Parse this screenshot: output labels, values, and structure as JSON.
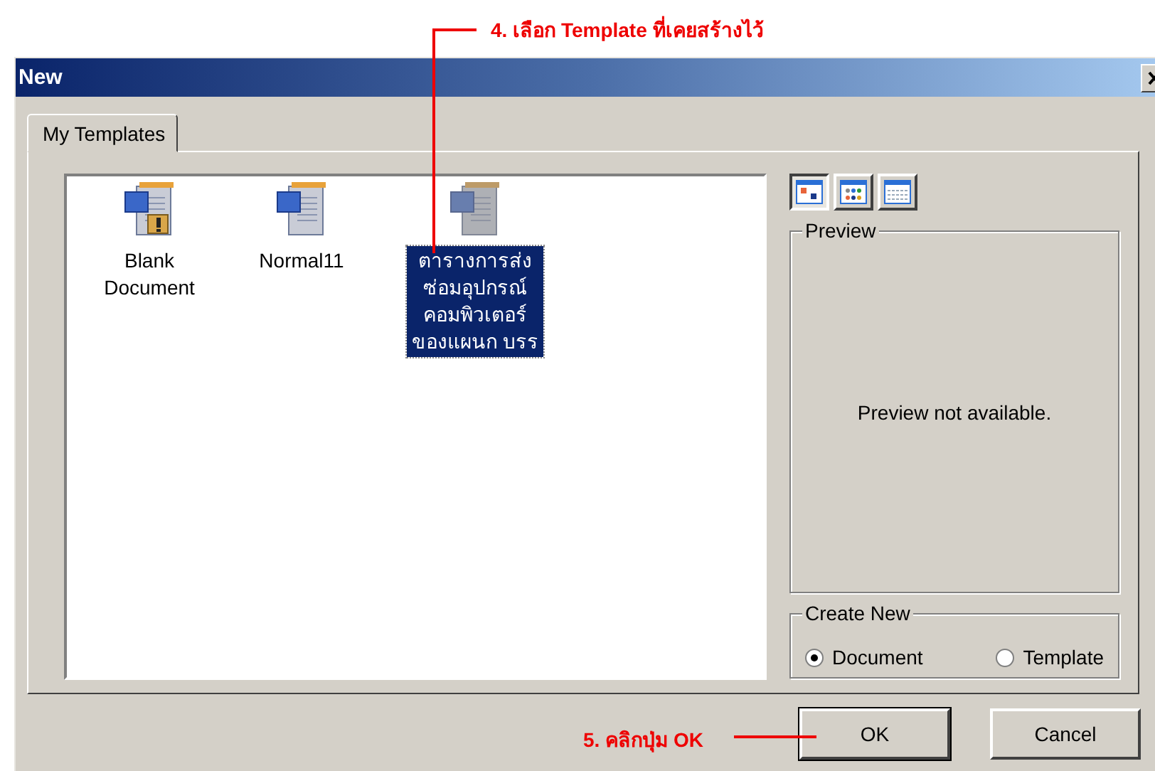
{
  "annotations": [
    {
      "kind": "callout-top",
      "text": "4. เลือก Template ที่เคยสร้างไว้"
    },
    {
      "kind": "callout-left",
      "text": "5. คลิกปุ่ม OK"
    }
  ],
  "window": {
    "title": "New"
  },
  "tabs": [
    {
      "label": "My Templates",
      "selected": true
    }
  ],
  "templates": [
    {
      "kind": "blank",
      "label_lines": [
        "Blank",
        "Document"
      ],
      "selected": false
    },
    {
      "kind": "word",
      "label_lines": [
        "Normal11"
      ],
      "selected": false
    },
    {
      "kind": "word",
      "label_lines": [
        "ตารางการส่ง",
        "ซ่อมอุปกรณ์",
        "คอมพิวเตอร์",
        "ของแผนก บรร"
      ],
      "selected": true
    }
  ],
  "view_buttons": [
    {
      "kind": "large-icons",
      "selected": true
    },
    {
      "kind": "list",
      "selected": false
    },
    {
      "kind": "details",
      "selected": false
    }
  ],
  "preview": {
    "title": "Preview",
    "message": "Preview not available."
  },
  "create_new": {
    "title": "Create New",
    "options": [
      {
        "label": "Document",
        "selected": true
      },
      {
        "label": "Template",
        "selected": false
      }
    ]
  },
  "buttons": [
    {
      "label": "OK",
      "default": true
    },
    {
      "label": "Cancel",
      "default": false
    }
  ]
}
